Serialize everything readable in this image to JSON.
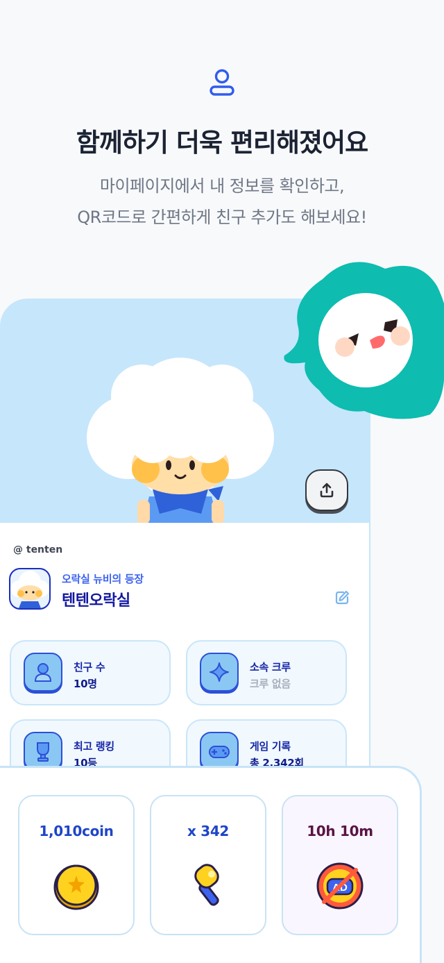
{
  "header": {
    "icon": "user-icon",
    "title": "함께하기 더욱 편리해졌어요",
    "subtitle_line1": "마이페이지에서 내 정보를 확인하고,",
    "subtitle_line2": "QR코드로 간편하게 친구 추가도 해보세요!"
  },
  "colors": {
    "accent": "#3d63f0",
    "phone_bg": "#c6e6fb",
    "mascot_teal": "#0ebcb0",
    "title": "#1b2333"
  },
  "profile": {
    "handle": "@ tenten",
    "subtitle": "오락실 뉴비의 등장",
    "name": "텐텐오락실",
    "share_icon": "share-upload-icon",
    "edit_icon": "pencil-edit-icon"
  },
  "stats": [
    {
      "label": "친구 수",
      "value": "10명",
      "icon": "friends-icon"
    },
    {
      "label": "소속 크루",
      "value": "크루 없음",
      "icon": "crew-sparkle-icon"
    },
    {
      "label": "최고 랭킹",
      "value": "10등",
      "icon": "trophy-icon"
    },
    {
      "label": "게임 기록",
      "value": "총 2,342회",
      "icon": "gamepad-icon"
    }
  ],
  "rewards": [
    {
      "value": "1,010coin",
      "icon": "coin-icon"
    },
    {
      "value": "x 342",
      "icon": "hammer-icon"
    },
    {
      "value": "10h 10m",
      "icon": "no-ad-icon"
    }
  ]
}
